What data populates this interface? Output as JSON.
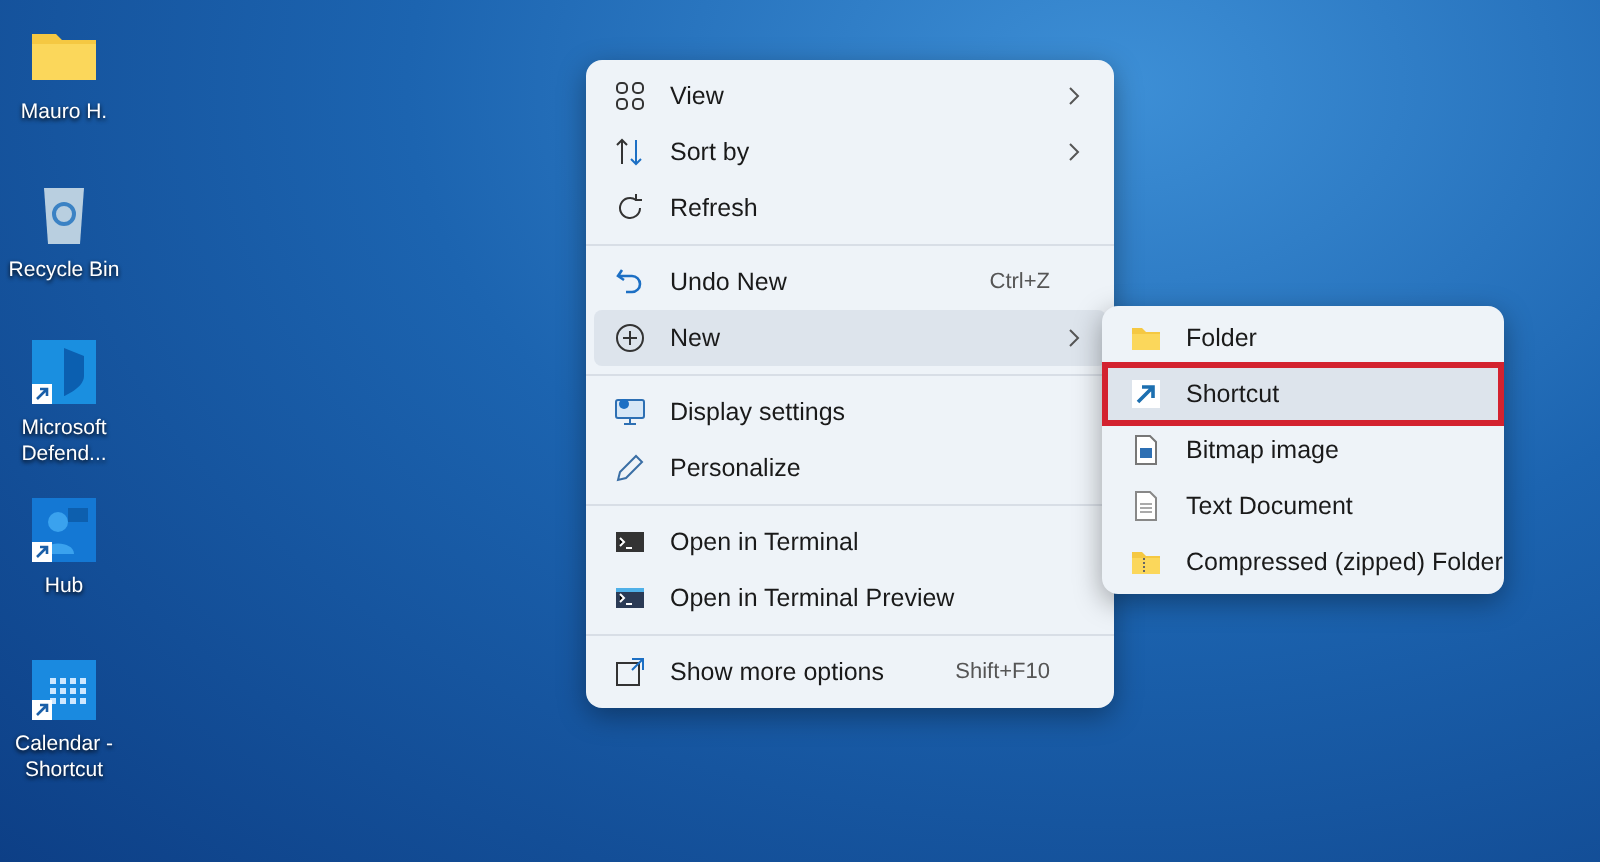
{
  "desktop_icons": [
    {
      "label": "Mauro H.",
      "shortcut": false
    },
    {
      "label": "Recycle Bin",
      "shortcut": false
    },
    {
      "label": "Microsoft Defend...",
      "shortcut": true
    },
    {
      "label": "Hub",
      "shortcut": true
    },
    {
      "label": "Calendar - Shortcut",
      "shortcut": true
    }
  ],
  "context_menu": {
    "groups": [
      [
        {
          "label": "View",
          "submenu": true,
          "selected": false
        },
        {
          "label": "Sort by",
          "submenu": true,
          "selected": false
        },
        {
          "label": "Refresh",
          "submenu": false,
          "selected": false
        }
      ],
      [
        {
          "label": "Undo New",
          "shortcut": "Ctrl+Z",
          "submenu": false,
          "selected": false
        },
        {
          "label": "New",
          "submenu": true,
          "selected": true
        }
      ],
      [
        {
          "label": "Display settings",
          "submenu": false,
          "selected": false
        },
        {
          "label": "Personalize",
          "submenu": false,
          "selected": false
        }
      ],
      [
        {
          "label": "Open in Terminal",
          "submenu": false,
          "selected": false
        },
        {
          "label": "Open in Terminal Preview",
          "submenu": false,
          "selected": false
        }
      ],
      [
        {
          "label": "Show more options",
          "shortcut": "Shift+F10",
          "submenu": false,
          "selected": false
        }
      ]
    ]
  },
  "new_submenu": {
    "items": [
      {
        "label": "Folder",
        "selected": false,
        "outlined": false
      },
      {
        "label": "Shortcut",
        "selected": true,
        "outlined": true
      },
      {
        "label": "Bitmap image",
        "selected": false,
        "outlined": false
      },
      {
        "label": "Text Document",
        "selected": false,
        "outlined": false
      },
      {
        "label": "Compressed (zipped) Folder",
        "selected": false,
        "outlined": false
      }
    ]
  }
}
